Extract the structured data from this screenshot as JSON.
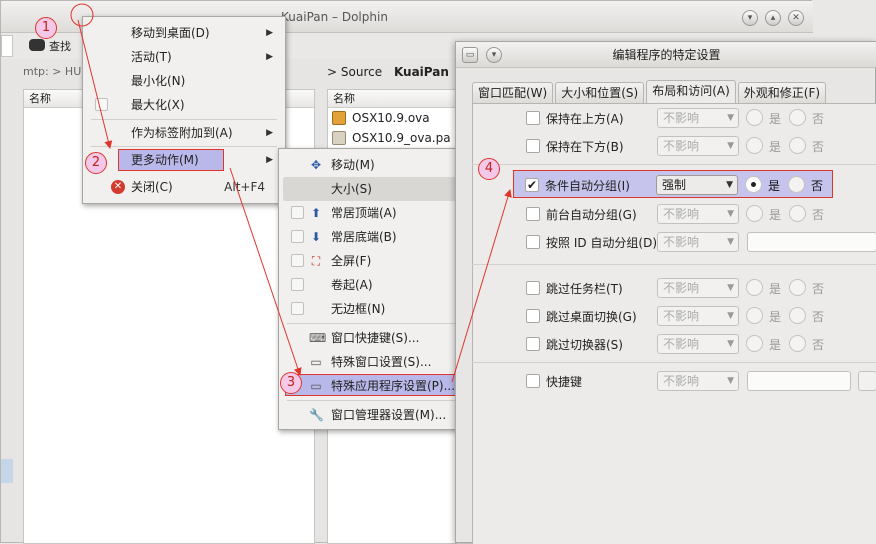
{
  "dolphin": {
    "title": "KuaiPan – Dolphin",
    "find_label": "查找",
    "left_address": "mtp: > HU",
    "left_col_header": "名称",
    "breadcrumb_parent": "Source",
    "breadcrumb_current": "KuaiPan",
    "right_col_header": "名称",
    "files": [
      "OSX10.9.ova",
      "OSX10.9_ova.pa"
    ]
  },
  "window_menu": {
    "items": [
      {
        "label": "移动到桌面(D)",
        "has_submenu": true
      },
      {
        "label": "活动(T)",
        "has_submenu": true
      },
      {
        "label": "最小化(N)"
      },
      {
        "label": "最大化(X)"
      },
      {
        "label": "作为标签附加到(A)",
        "has_submenu": true
      },
      {
        "label": "更多动作(M)",
        "has_submenu": true
      },
      {
        "label": "关闭(C)",
        "shortcut": "Alt+F4"
      }
    ]
  },
  "submenu": {
    "items": [
      {
        "label": "移动(M)",
        "icon": "move-icon"
      },
      {
        "label": "大小(S)"
      },
      {
        "label": "常居顶端(A)",
        "icon": "arrow-up-icon"
      },
      {
        "label": "常居底端(B)",
        "icon": "arrow-down-icon"
      },
      {
        "label": "全屏(F)",
        "icon": "fullscreen-icon"
      },
      {
        "label": "卷起(A)"
      },
      {
        "label": "无边框(N)"
      },
      {
        "label": "窗口快捷键(S)...",
        "icon": "keyboard-icon"
      },
      {
        "label": "特殊窗口设置(S)...",
        "icon": "window-settings-icon"
      },
      {
        "label": "特殊应用程序设置(P)...",
        "icon": "app-settings-icon"
      },
      {
        "label": "窗口管理器设置(M)...",
        "icon": "wrench-icon"
      }
    ]
  },
  "dialog": {
    "title": "编辑程序的特定设置",
    "tabs": [
      "窗口匹配(W)",
      "大小和位置(S)",
      "布局和访问(A)",
      "外观和修正(F)"
    ],
    "active_tab": "布局和访问(A)",
    "yes_label": "是",
    "no_label": "否",
    "rows": [
      {
        "label": "保持在上方(A)",
        "value": "不影响",
        "checked": false
      },
      {
        "label": "保持在下方(B)",
        "value": "不影响",
        "checked": false
      },
      {
        "label": "条件自动分组(I)",
        "value": "强制",
        "checked": true
      },
      {
        "label": "前台自动分组(G)",
        "value": "不影响",
        "checked": false
      },
      {
        "label": "按照 ID 自动分组(D)",
        "value": "不影响",
        "checked": false
      },
      {
        "label": "跳过任务栏(T)",
        "value": "不影响",
        "checked": false
      },
      {
        "label": "跳过桌面切换(G)",
        "value": "不影响",
        "checked": false
      },
      {
        "label": "跳过切换器(S)",
        "value": "不影响",
        "checked": false
      },
      {
        "label": "快捷键",
        "value": "不影响",
        "checked": false
      }
    ]
  },
  "annotations": [
    "1",
    "2",
    "3",
    "4"
  ],
  "colors": {
    "highlight": "#b9b8ea",
    "annotation_red": "#e0352b"
  }
}
